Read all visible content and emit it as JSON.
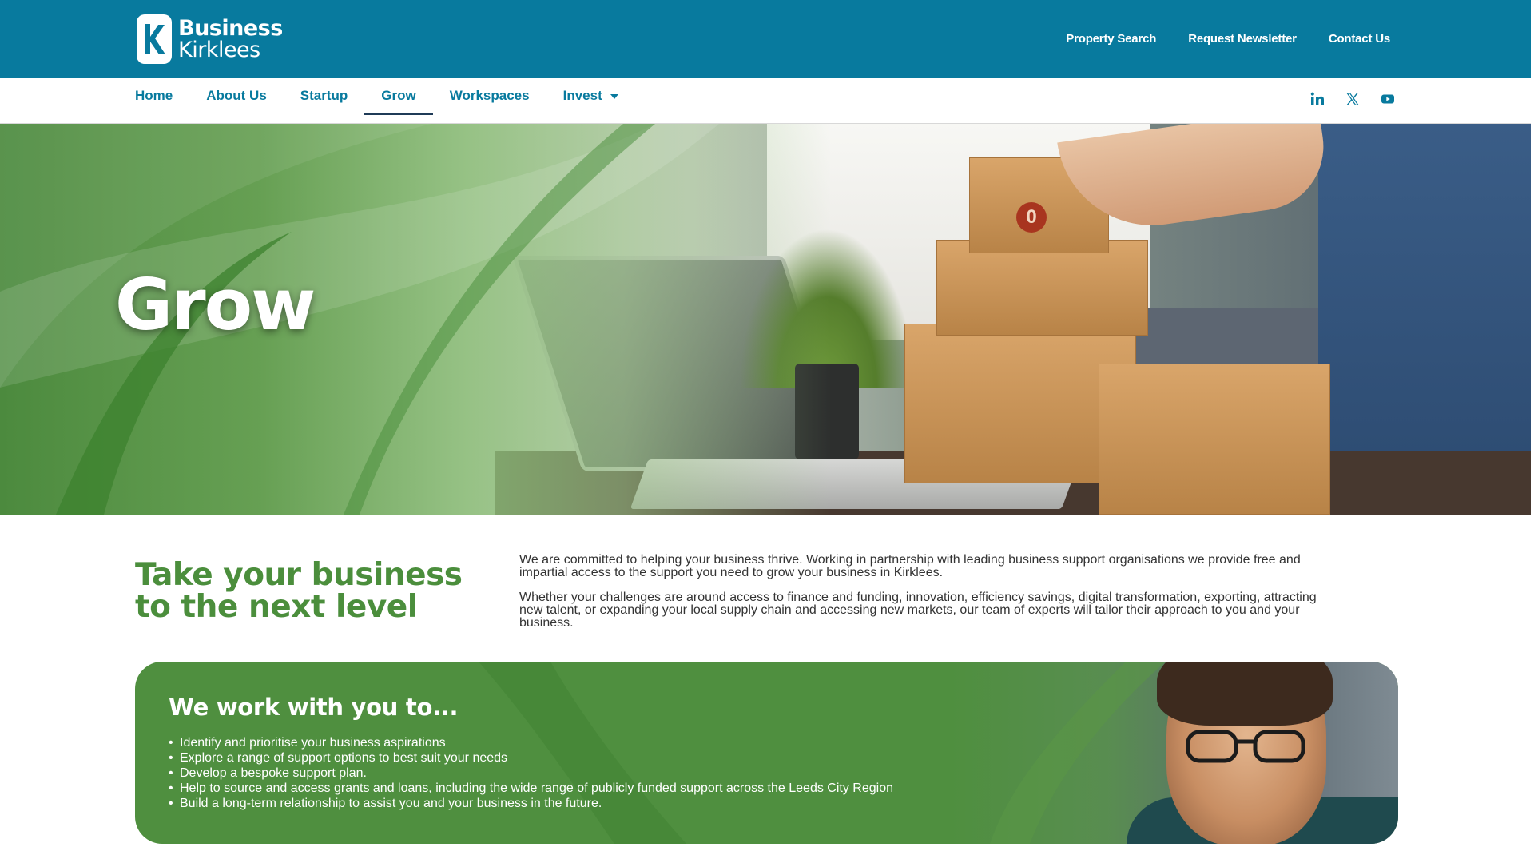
{
  "brand": {
    "logo_line1": "Business",
    "logo_line2": "Kirklees",
    "primary_color": "#087a9e",
    "green_color": "#4b8e3c"
  },
  "utility_nav": [
    {
      "label": "Property Search"
    },
    {
      "label": "Request Newsletter"
    },
    {
      "label": "Contact Us"
    }
  ],
  "main_nav": [
    {
      "label": "Home"
    },
    {
      "label": "About Us"
    },
    {
      "label": "Startup"
    },
    {
      "label": "Grow",
      "active": true
    },
    {
      "label": "Workspaces"
    },
    {
      "label": "Invest",
      "has_dropdown": true
    }
  ],
  "social": [
    {
      "icon": "linkedin-icon"
    },
    {
      "icon": "x-twitter-icon"
    },
    {
      "icon": "youtube-icon"
    }
  ],
  "hero": {
    "title": "Grow",
    "box_label": "0"
  },
  "intro": {
    "heading": "Take your business to the next level",
    "paragraphs": [
      "We are committed to helping your business thrive. Working in partnership with leading business support organisations we provide free and impartial access to the support you need to grow your business in Kirklees.",
      "Whether your challenges are around access to finance and funding, innovation, efficiency savings, digital transformation, exporting, attracting new talent, or expanding your local supply chain and accessing new markets, our team of experts will tailor their approach to you and your business."
    ]
  },
  "work_with_you": {
    "title": "We work with you to...",
    "items": [
      "Identify and prioritise your business aspirations",
      "Explore a range of support options to best suit your needs",
      "Develop a bespoke support plan.",
      "Help to source and access grants and loans, including the wide range of publicly funded support across the Leeds City Region",
      "Build a long-term relationship to assist you and your business in the future."
    ]
  }
}
